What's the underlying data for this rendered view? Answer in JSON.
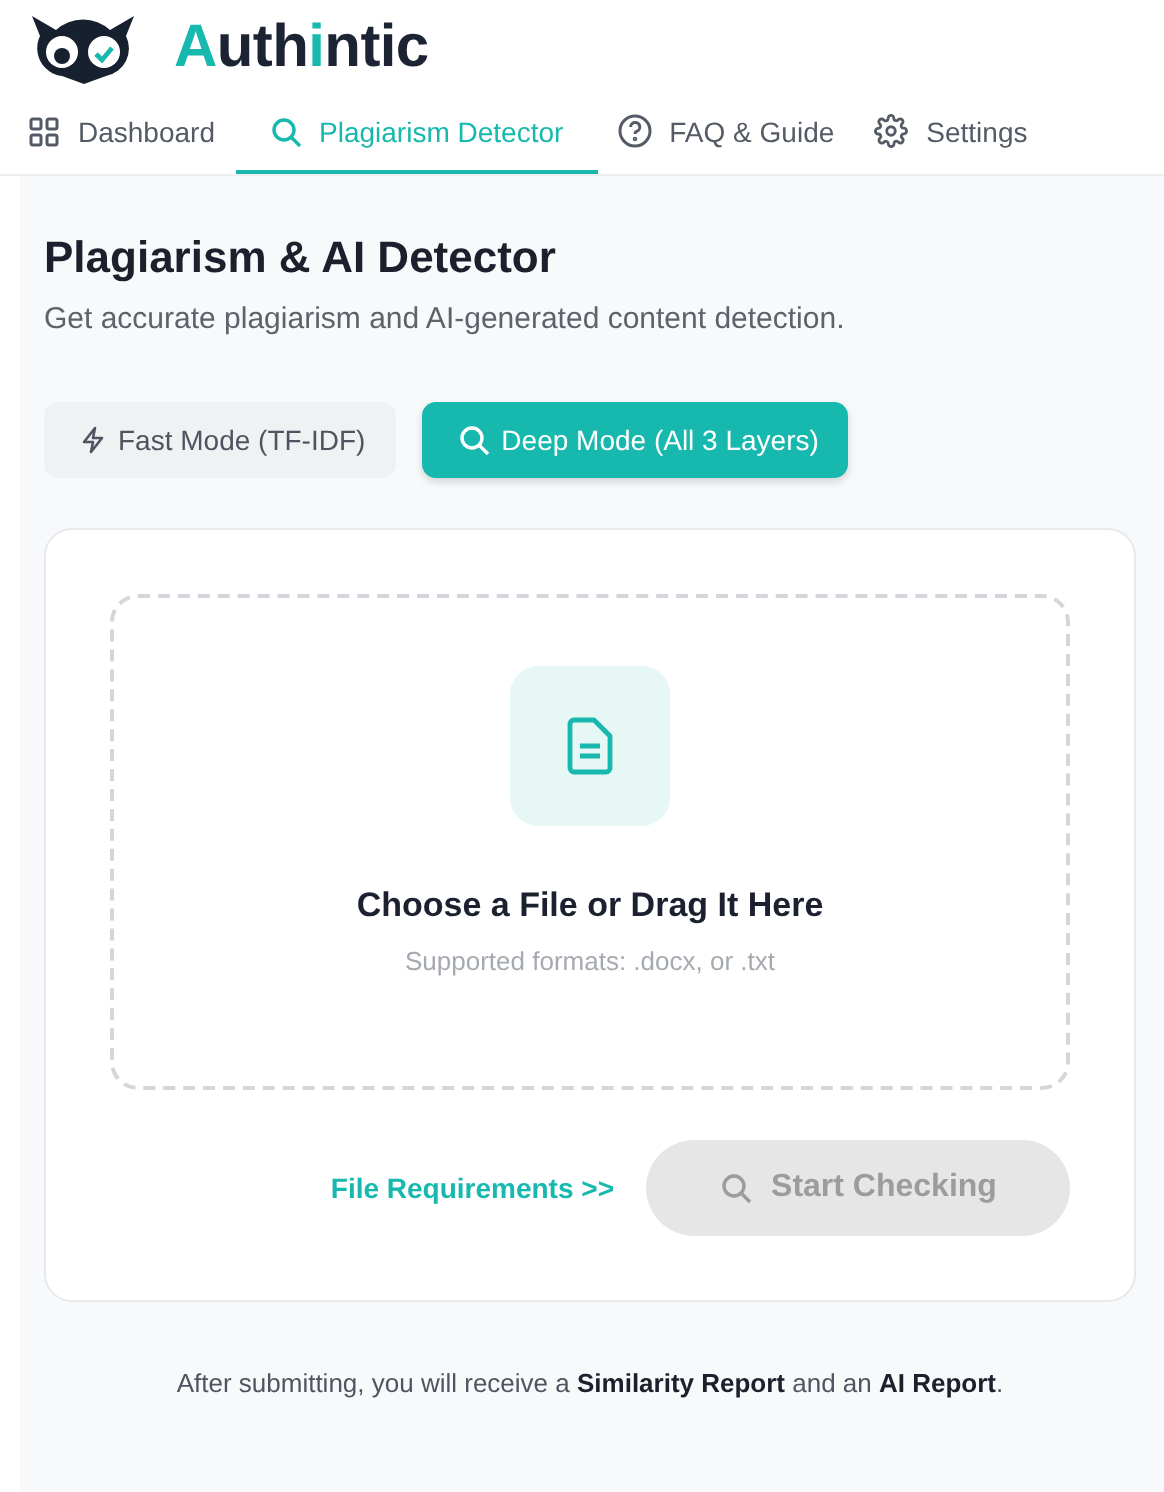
{
  "logo": {
    "segments": [
      {
        "text": "A",
        "accent": true
      },
      {
        "text": "uth",
        "accent": false
      },
      {
        "text": "i",
        "accent": true
      },
      {
        "text": "ntic",
        "accent": false
      }
    ]
  },
  "tabs": [
    {
      "label": "Dashboard",
      "selected": false
    },
    {
      "label": "Plagiarism Detector",
      "selected": true
    },
    {
      "label": "FAQ & Guide",
      "selected": false
    },
    {
      "label": "Settings",
      "selected": false
    }
  ],
  "page": {
    "title": "Plagiarism & AI Detector",
    "subtitle": "Get accurate plagiarism and AI-generated content detection."
  },
  "modes": [
    {
      "label": "Fast Mode (TF-IDF)",
      "selected": false
    },
    {
      "label": "Deep Mode (All 3 Layers)",
      "selected": true
    }
  ],
  "upload": {
    "title": "Choose a File or Drag It Here",
    "hint": "Supported formats: .docx, or .txt"
  },
  "requirements_link": "File Requirements >>",
  "start_button": {
    "label": "Start Checking",
    "disabled": true
  },
  "footer_note": "After submitting, you will receive a **Similarity Report** and an **AI Report**."
}
